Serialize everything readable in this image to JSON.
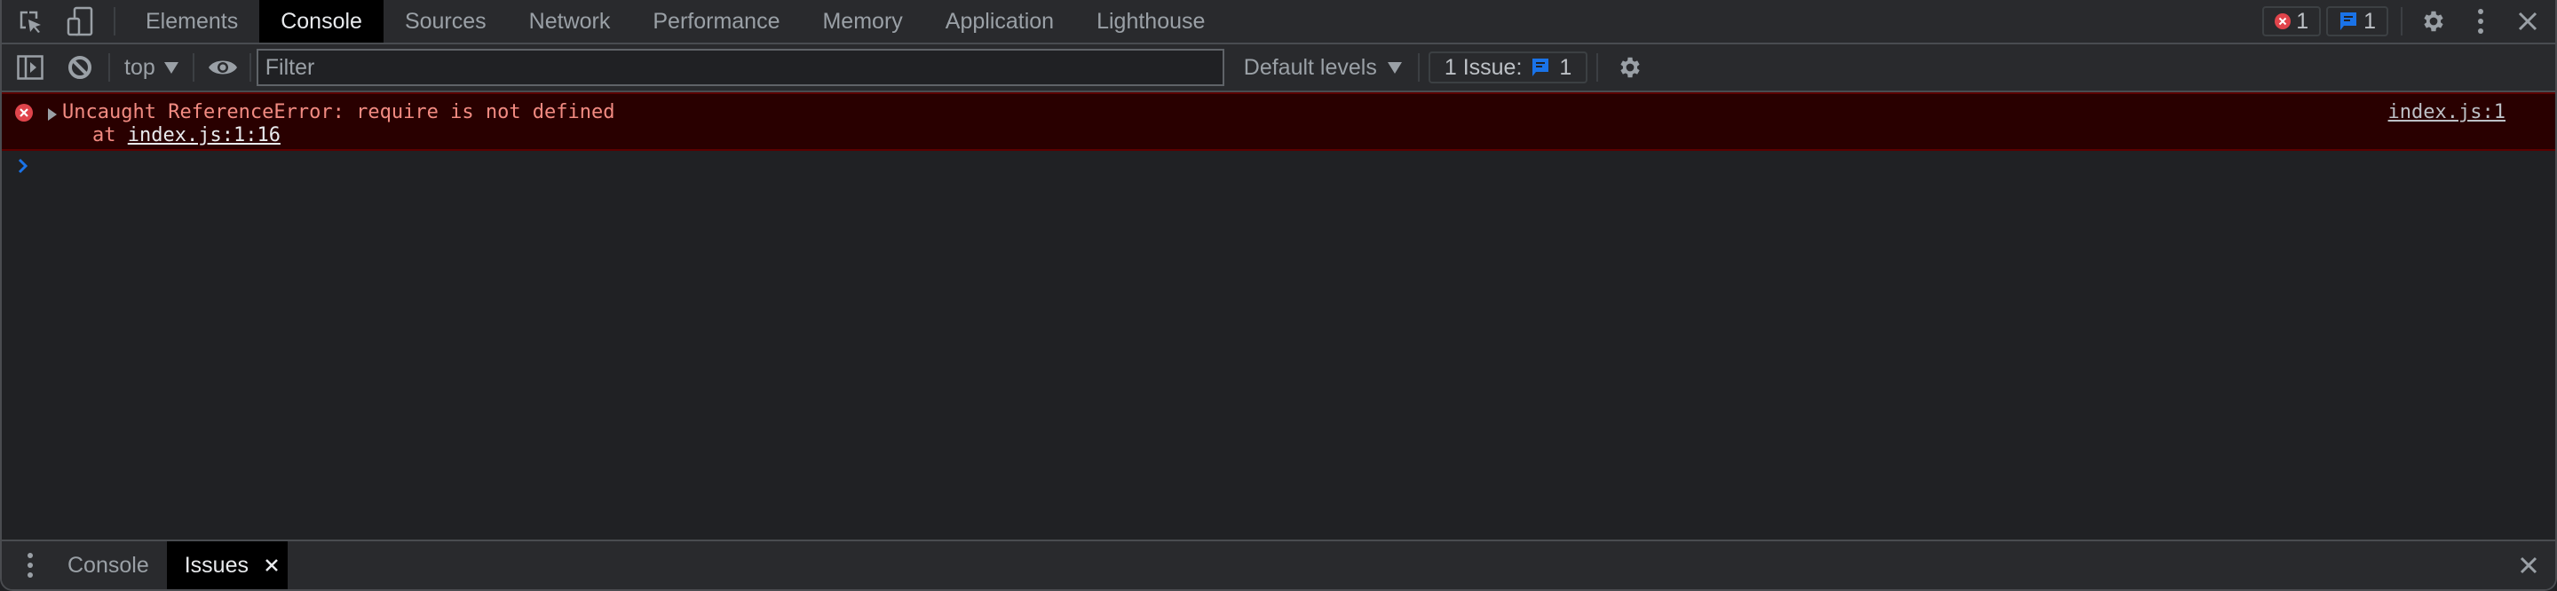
{
  "tabbar": {
    "tabs": [
      {
        "label": "Elements",
        "active": false
      },
      {
        "label": "Console",
        "active": true
      },
      {
        "label": "Sources",
        "active": false
      },
      {
        "label": "Network",
        "active": false
      },
      {
        "label": "Performance",
        "active": false
      },
      {
        "label": "Memory",
        "active": false
      },
      {
        "label": "Application",
        "active": false
      },
      {
        "label": "Lighthouse",
        "active": false
      }
    ],
    "error_count": "1",
    "message_count": "1",
    "icons": {
      "inspect": "inspect-element-icon",
      "device": "device-toolbar-icon",
      "settings": "gear-icon",
      "more": "more-vertical-icon",
      "close": "close-icon"
    }
  },
  "toolbar": {
    "context": "top",
    "filter_placeholder": "Filter",
    "filter_value": "",
    "levels": "Default levels",
    "issues_label": "1 Issue:",
    "issues_count": "1",
    "icons": {
      "sidebar": "show-sidebar-icon",
      "clear": "clear-console-icon",
      "live_expression": "eye-icon",
      "settings": "gear-icon"
    }
  },
  "console": {
    "messages": [
      {
        "level": "error",
        "text": "Uncaught ReferenceError: require is not defined",
        "stack_prefix": "at ",
        "stack_link": "index.js:1:16",
        "source": "index.js:1"
      }
    ],
    "prompt": ""
  },
  "drawer": {
    "tabs": [
      {
        "label": "Console",
        "active": false
      },
      {
        "label": "Issues",
        "active": true,
        "closable": true
      }
    ]
  },
  "colors": {
    "error_text": "#f28b82",
    "error_bg": "#290000",
    "error_icon": "#e0444b",
    "info_icon": "#1a73e8",
    "prompt": "#1a73e8"
  }
}
